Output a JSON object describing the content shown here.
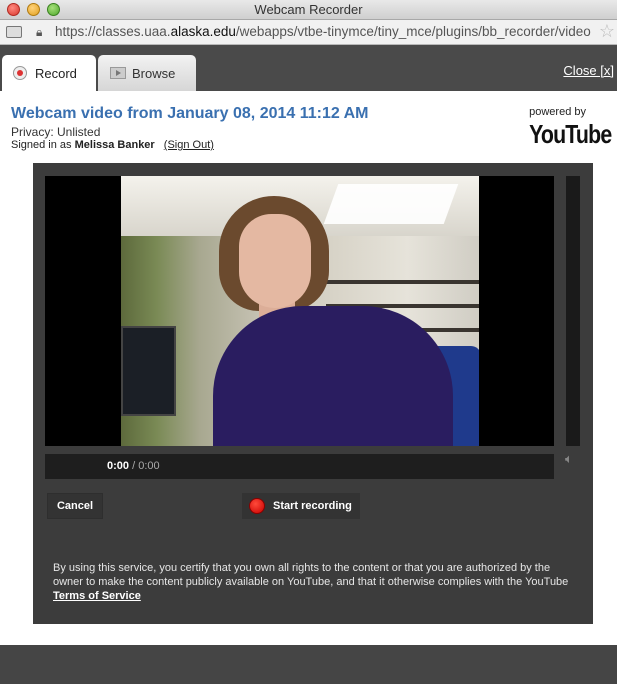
{
  "window": {
    "title": "Webcam Recorder"
  },
  "urlbar": {
    "prefix": "https://classes.uaa.",
    "domain": "alaska.edu",
    "path": "/webapps/vtbe-tinymce/tiny_mce/plugins/bb_recorder/video"
  },
  "tabs": [
    {
      "label": "Record",
      "icon": "record-icon",
      "active": true
    },
    {
      "label": "Browse",
      "icon": "play-icon",
      "active": false
    }
  ],
  "close_label": "Close [x]",
  "header": {
    "title": "Webcam video from January 08, 2014 11:12 AM",
    "privacy": "Privacy: Unlisted",
    "signed_in_prefix": "Signed in as",
    "user": "Melissa Banker",
    "sign_out": "(Sign Out)"
  },
  "brand": {
    "powered_by": "powered by",
    "logo": "YouTube"
  },
  "player": {
    "time_current": "0:00",
    "separator": " / ",
    "time_total": "0:00"
  },
  "buttons": {
    "cancel": "Cancel",
    "start_recording": "Start recording"
  },
  "legal": {
    "text": "By using this service, you certify that you own all rights to the content or that you are authorized by the owner to make the content publicly available on YouTube, and that it otherwise complies with the YouTube ",
    "tos": "Terms of Service"
  },
  "colors": {
    "title_blue": "#3a70b0",
    "record_red": "#d00000",
    "panel_bg": "#3c3c3c"
  }
}
